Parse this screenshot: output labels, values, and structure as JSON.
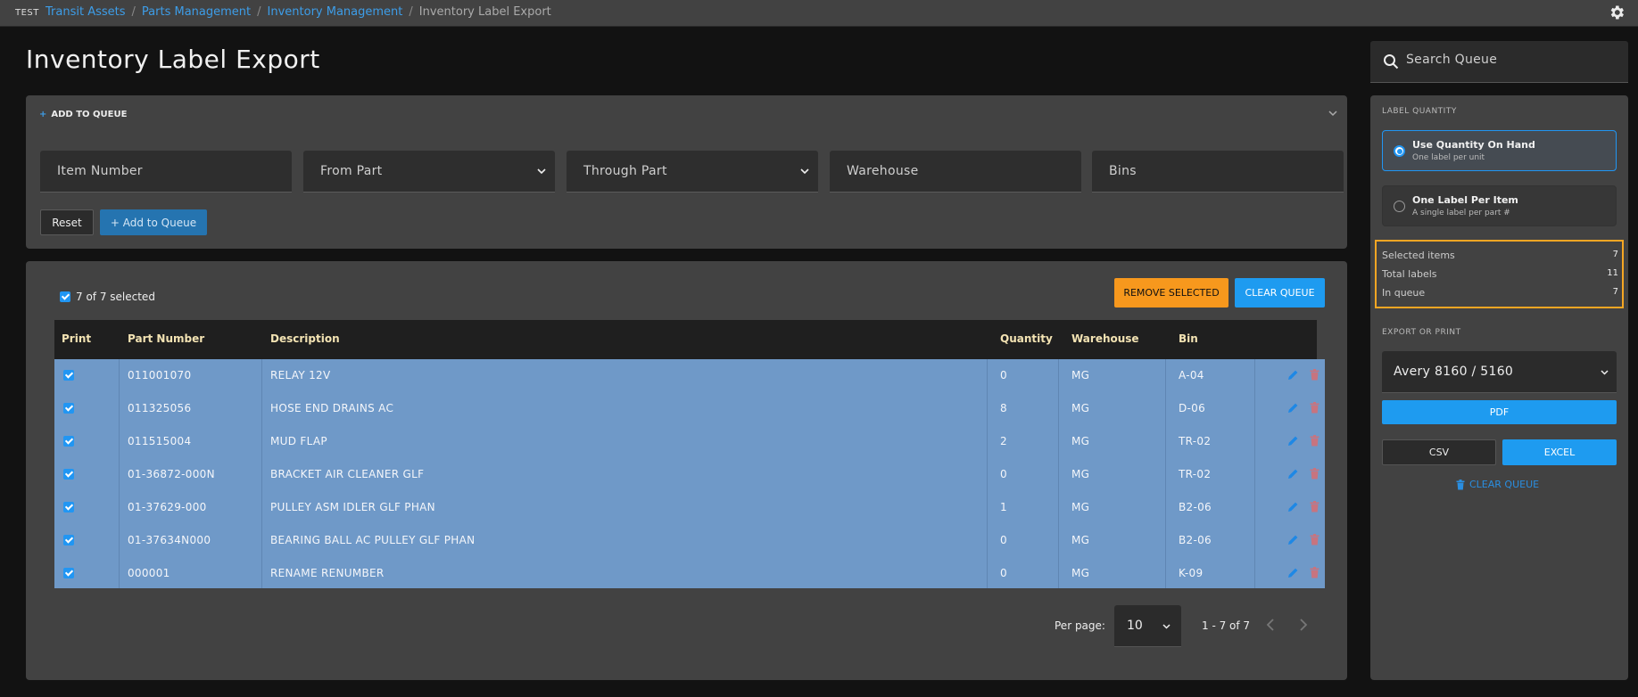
{
  "topbar": {
    "env": "TEST",
    "breadcrumbs": [
      "Transit Assets",
      "Parts Management",
      "Inventory Management"
    ],
    "current": "Inventory Label Export",
    "separator": "/"
  },
  "page": {
    "title": "Inventory Label Export"
  },
  "add_panel": {
    "header": "ADD TO QUEUE",
    "fields": {
      "item_number": "Item Number",
      "from_part": "From Part",
      "through_part": "Through Part",
      "warehouse": "Warehouse",
      "bins": "Bins"
    },
    "reset_label": "Reset",
    "add_label": "+ Add to Queue"
  },
  "queue": {
    "selection_text": "7 of 7 selected",
    "remove_label": "REMOVE SELECTED",
    "clear_label": "CLEAR QUEUE",
    "columns": {
      "print": "Print",
      "part_number": "Part Number",
      "description": "Description",
      "quantity": "Quantity",
      "warehouse": "Warehouse",
      "bin": "Bin"
    },
    "rows": [
      {
        "part": "011001070",
        "desc": "RELAY 12V",
        "qty": "0",
        "wh": "MG",
        "bin": "A-04"
      },
      {
        "part": "011325056",
        "desc": "HOSE END DRAINS AC",
        "qty": "8",
        "wh": "MG",
        "bin": "D-06"
      },
      {
        "part": "011515004",
        "desc": "MUD FLAP",
        "qty": "2",
        "wh": "MG",
        "bin": "TR-02"
      },
      {
        "part": "01-36872-000N",
        "desc": "BRACKET AIR CLEANER GLF",
        "qty": "0",
        "wh": "MG",
        "bin": "TR-02"
      },
      {
        "part": "01-37629-000",
        "desc": "PULLEY ASM IDLER GLF PHAN",
        "qty": "1",
        "wh": "MG",
        "bin": "B2-06"
      },
      {
        "part": "01-37634N000",
        "desc": "BEARING BALL AC PULLEY GLF PHAN",
        "qty": "0",
        "wh": "MG",
        "bin": "B2-06"
      },
      {
        "part": "000001",
        "desc": "RENAME RENUMBER",
        "qty": "0",
        "wh": "MG",
        "bin": "K-09"
      }
    ],
    "pagination": {
      "per_page_label": "Per page:",
      "per_page": "10",
      "range": "1 - 7 of 7"
    }
  },
  "sidebar": {
    "search_placeholder": "Search Queue",
    "label_quantity_title": "LABEL QUANTITY",
    "options": [
      {
        "title": "Use Quantity On Hand",
        "subtitle": "One label per unit",
        "selected": true
      },
      {
        "title": "One Label Per Item",
        "subtitle": "A single label per part #",
        "selected": false
      }
    ],
    "stats": [
      {
        "label": "Selected items",
        "value": "7"
      },
      {
        "label": "Total labels",
        "value": "11"
      },
      {
        "label": "In queue",
        "value": "7"
      }
    ],
    "export_title": "EXPORT OR PRINT",
    "template": "Avery 8160 / 5160",
    "pdf_label": "PDF",
    "csv_label": "CSV",
    "excel_label": "EXCEL",
    "clear_label": "CLEAR QUEUE"
  },
  "colors": {
    "accent": "#2196f3",
    "warning": "#f7981d",
    "selected_row": "#6f99c8",
    "highlight_border": "#f5a623"
  }
}
